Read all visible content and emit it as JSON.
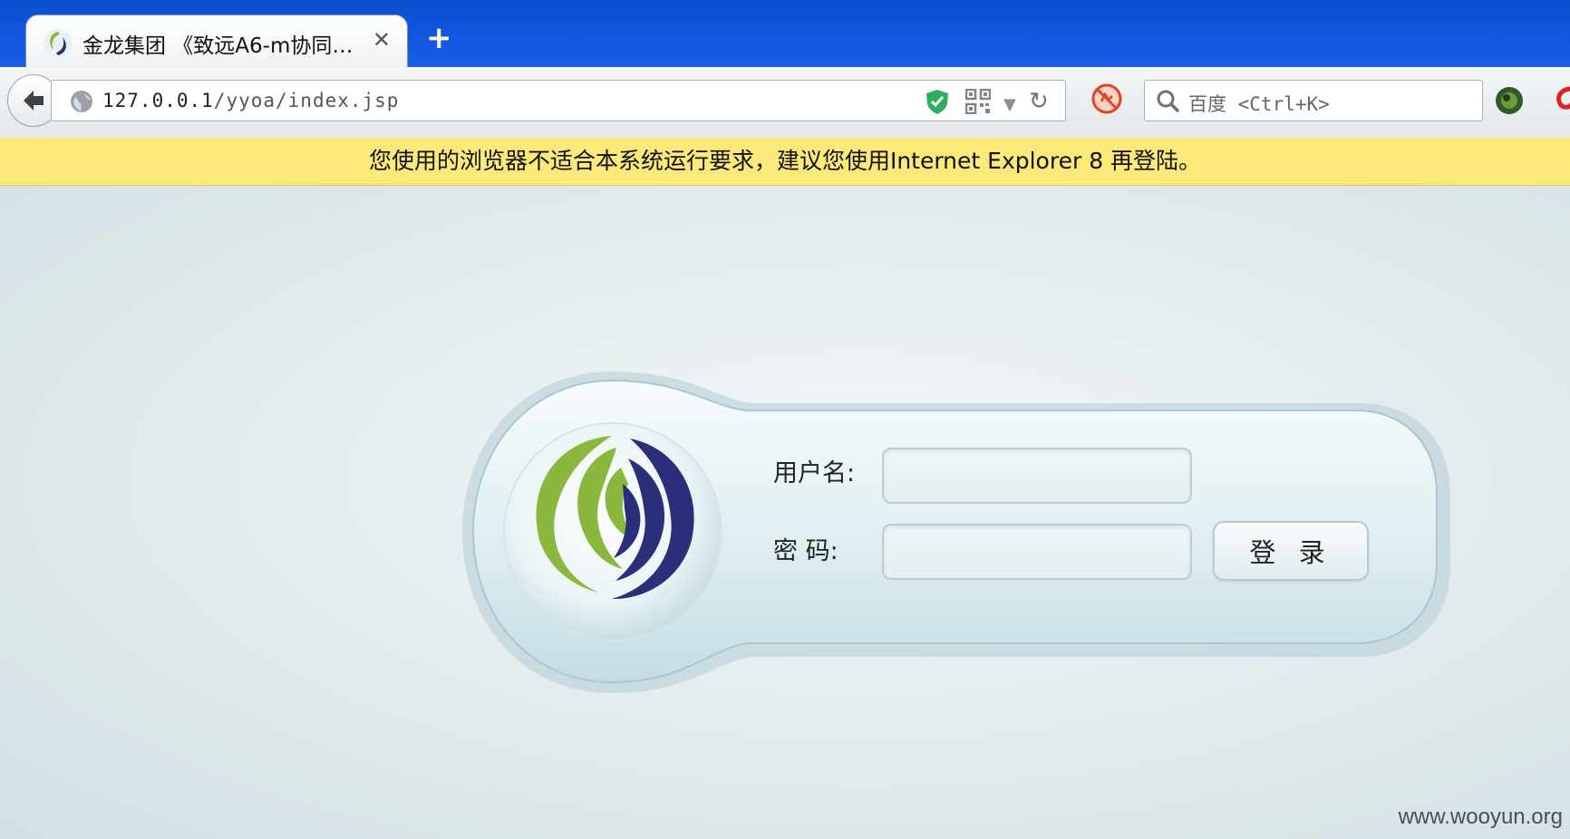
{
  "browser": {
    "tab_title": "金龙集团 《致远A6-m协同…",
    "tab_close": "✕",
    "new_tab": "+",
    "url_host": "127.0.0.1",
    "url_path": "/yyoa/index.jsp",
    "search_placeholder": "百度 <Ctrl+K>"
  },
  "notification": {
    "text": "您使用的浏览器不适合本系统运行要求，建议您使用Internet Explorer 8 再登陆。"
  },
  "login": {
    "username_label": "用户名:",
    "password_label": "密  码:",
    "username_value": "",
    "password_value": "",
    "login_button": "登 录"
  },
  "watermark": "www.wooyun.org",
  "colors": {
    "titlebar": "#1257e0",
    "notification_bg": "#fde87a",
    "logo_green": "#8ab83e",
    "logo_navy": "#2b2f7a"
  }
}
